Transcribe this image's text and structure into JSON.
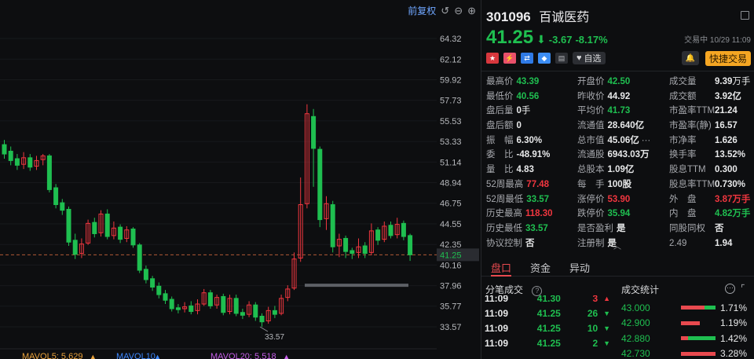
{
  "chart": {
    "toolbar": {
      "adjust_label": "前复权"
    },
    "price_ticks": [
      "64.32",
      "62.12",
      "59.92",
      "57.73",
      "55.53",
      "53.33",
      "51.14",
      "48.94",
      "46.75",
      "44.55",
      "42.35",
      "40.16",
      "37.96",
      "35.77",
      "33.57"
    ],
    "current_price_tag": "41.25",
    "low_label": "33.57",
    "mavol": [
      {
        "label": "MAVOL5: 5.629",
        "color": "#e9a23b"
      },
      {
        "label": "MAVOL10",
        "color": "#3d88ff"
      },
      {
        "label": "MAVOL20: 5.518",
        "color": "#c65ee8"
      }
    ],
    "colors": {
      "up": "#f0363f",
      "down": "#1fbf50",
      "dash": "#b05a36"
    }
  },
  "chart_data": {
    "type": "candlestick",
    "y_axis_ticks": [
      64.32,
      62.12,
      59.92,
      57.73,
      55.53,
      53.33,
      51.14,
      48.94,
      46.75,
      44.55,
      42.35,
      40.16,
      37.96,
      35.77,
      33.57
    ],
    "current_price": 41.25,
    "period_low": 33.57,
    "candles": [
      {
        "o": 53.0,
        "c": 52.0,
        "h": 53.5,
        "l": 51.5
      },
      {
        "o": 52.3,
        "c": 51.3,
        "h": 52.8,
        "l": 50.8
      },
      {
        "o": 51.5,
        "c": 50.8,
        "h": 52.0,
        "l": 50.3
      },
      {
        "o": 50.9,
        "c": 51.6,
        "h": 52.2,
        "l": 50.4
      },
      {
        "o": 51.6,
        "c": 50.6,
        "h": 52.0,
        "l": 50.2
      },
      {
        "o": 50.7,
        "c": 51.3,
        "h": 51.8,
        "l": 50.3
      },
      {
        "o": 51.4,
        "c": 51.8,
        "h": 52.0,
        "l": 50.8
      },
      {
        "o": 51.8,
        "c": 48.2,
        "h": 52.0,
        "l": 47.9
      },
      {
        "o": 48.4,
        "c": 46.6,
        "h": 48.8,
        "l": 46.2
      },
      {
        "o": 46.8,
        "c": 46.0,
        "h": 47.2,
        "l": 45.5
      },
      {
        "o": 46.1,
        "c": 42.6,
        "h": 46.4,
        "l": 42.2
      },
      {
        "o": 42.8,
        "c": 41.3,
        "h": 43.5,
        "l": 40.8
      },
      {
        "o": 41.4,
        "c": 42.4,
        "h": 43.0,
        "l": 40.9
      },
      {
        "o": 42.5,
        "c": 44.6,
        "h": 45.0,
        "l": 42.3
      },
      {
        "o": 44.7,
        "c": 43.5,
        "h": 45.2,
        "l": 43.1
      },
      {
        "o": 43.6,
        "c": 45.6,
        "h": 46.0,
        "l": 43.2
      },
      {
        "o": 45.6,
        "c": 43.2,
        "h": 46.1,
        "l": 42.9
      },
      {
        "o": 43.3,
        "c": 44.1,
        "h": 44.8,
        "l": 42.9
      },
      {
        "o": 44.2,
        "c": 42.9,
        "h": 44.5,
        "l": 42.5
      },
      {
        "o": 43.0,
        "c": 43.9,
        "h": 44.3,
        "l": 42.6
      },
      {
        "o": 44.0,
        "c": 42.3,
        "h": 44.2,
        "l": 42.0
      },
      {
        "o": 42.3,
        "c": 39.6,
        "h": 42.5,
        "l": 39.3
      },
      {
        "o": 39.7,
        "c": 38.6,
        "h": 40.1,
        "l": 38.2
      },
      {
        "o": 38.7,
        "c": 37.8,
        "h": 39.0,
        "l": 37.4
      },
      {
        "o": 37.9,
        "c": 37.0,
        "h": 38.3,
        "l": 36.6
      },
      {
        "o": 37.1,
        "c": 36.4,
        "h": 37.5,
        "l": 36.0
      },
      {
        "o": 36.5,
        "c": 35.5,
        "h": 36.8,
        "l": 35.2
      },
      {
        "o": 35.6,
        "c": 35.4,
        "h": 36.0,
        "l": 35.0
      },
      {
        "o": 35.5,
        "c": 35.7,
        "h": 36.2,
        "l": 35.1
      },
      {
        "o": 35.8,
        "c": 35.2,
        "h": 36.3,
        "l": 34.9
      },
      {
        "o": 35.3,
        "c": 36.0,
        "h": 36.5,
        "l": 34.9
      },
      {
        "o": 36.0,
        "c": 37.2,
        "h": 37.6,
        "l": 35.8
      },
      {
        "o": 37.2,
        "c": 35.8,
        "h": 37.5,
        "l": 35.5
      },
      {
        "o": 35.9,
        "c": 36.7,
        "h": 37.0,
        "l": 35.5
      },
      {
        "o": 36.8,
        "c": 35.1,
        "h": 37.1,
        "l": 34.8
      },
      {
        "o": 35.2,
        "c": 36.6,
        "h": 37.0,
        "l": 34.9
      },
      {
        "o": 36.6,
        "c": 35.0,
        "h": 37.0,
        "l": 34.7
      },
      {
        "o": 35.1,
        "c": 34.8,
        "h": 35.5,
        "l": 34.4
      },
      {
        "o": 34.9,
        "c": 35.9,
        "h": 36.3,
        "l": 34.6
      },
      {
        "o": 35.9,
        "c": 34.6,
        "h": 36.2,
        "l": 34.2
      },
      {
        "o": 34.7,
        "c": 34.1,
        "h": 35.0,
        "l": 33.57
      },
      {
        "o": 34.2,
        "c": 35.3,
        "h": 35.7,
        "l": 33.9
      },
      {
        "o": 35.3,
        "c": 34.9,
        "h": 35.8,
        "l": 34.5
      },
      {
        "o": 35.0,
        "c": 36.6,
        "h": 37.0,
        "l": 34.8
      },
      {
        "o": 36.7,
        "c": 37.6,
        "h": 38.0,
        "l": 36.3
      },
      {
        "o": 37.7,
        "c": 40.8,
        "h": 41.5,
        "l": 37.5
      },
      {
        "o": 40.9,
        "c": 46.6,
        "h": 49.5,
        "l": 40.5
      },
      {
        "o": 46.7,
        "c": 56.3,
        "h": 57.3,
        "l": 46.2
      },
      {
        "o": 56.0,
        "c": 52.6,
        "h": 56.8,
        "l": 48.5
      },
      {
        "o": 52.5,
        "c": 45.0,
        "h": 52.8,
        "l": 44.2
      },
      {
        "o": 45.1,
        "c": 46.7,
        "h": 47.5,
        "l": 43.9
      },
      {
        "o": 46.6,
        "c": 42.1,
        "h": 47.0,
        "l": 41.5
      },
      {
        "o": 42.2,
        "c": 42.9,
        "h": 43.5,
        "l": 41.0
      },
      {
        "o": 43.0,
        "c": 41.6,
        "h": 43.3,
        "l": 40.9
      },
      {
        "o": 41.7,
        "c": 41.4,
        "h": 42.0,
        "l": 40.8
      },
      {
        "o": 41.5,
        "c": 42.1,
        "h": 43.0,
        "l": 40.9
      },
      {
        "o": 42.2,
        "c": 41.4,
        "h": 42.6,
        "l": 40.9
      },
      {
        "o": 41.5,
        "c": 43.8,
        "h": 44.6,
        "l": 41.2
      },
      {
        "o": 43.9,
        "c": 42.8,
        "h": 44.2,
        "l": 42.3
      },
      {
        "o": 42.9,
        "c": 44.3,
        "h": 44.8,
        "l": 42.6
      },
      {
        "o": 44.4,
        "c": 43.3,
        "h": 44.8,
        "l": 43.0
      },
      {
        "o": 43.4,
        "c": 44.5,
        "h": 45.2,
        "l": 43.0
      },
      {
        "o": 44.6,
        "c": 43.2,
        "h": 44.9,
        "l": 42.8
      },
      {
        "o": 43.3,
        "c": 41.25,
        "h": 43.5,
        "l": 40.6
      }
    ]
  },
  "quote": {
    "code": "301096",
    "name": "百诚医药",
    "price": "41.25",
    "arrow": "⬇",
    "change": "-3.67",
    "change_pct": "-8.17%",
    "status": "交易中 10/29 11:09",
    "tags": [
      {
        "text": "★",
        "cls": "red",
        "name": "cn-flag-icon"
      },
      {
        "text": "⚡",
        "cls": "pink",
        "name": "margin-icon"
      },
      {
        "text": "⇄",
        "cls": "blue",
        "name": "connect-icon"
      },
      {
        "text": "◆",
        "cls": "blue2",
        "name": "tag-icon"
      },
      {
        "text": "▤",
        "cls": "gray",
        "name": "doc-icon"
      }
    ],
    "watch_label": "自选",
    "bell_icon": "bell-icon",
    "fast_trade_label": "快捷交易"
  },
  "stats": [
    [
      {
        "label": "最高价",
        "value": "43.39",
        "cls": "green"
      },
      {
        "label": "开盘价",
        "value": "42.50",
        "cls": "green"
      },
      {
        "label": "成交量",
        "value": "9.39",
        "unit": "万手",
        "cls": ""
      }
    ],
    [
      {
        "label": "最低价",
        "value": "40.56",
        "cls": "green"
      },
      {
        "label": "昨收价",
        "value": "44.92",
        "cls": ""
      },
      {
        "label": "成交额",
        "value": "3.92亿",
        "cls": ""
      }
    ],
    [
      {
        "label": "盘后量",
        "value": "0",
        "unit": "手",
        "cls": ""
      },
      {
        "label": "平均价",
        "value": "41.73",
        "cls": "green"
      },
      {
        "label": "市盈率TTM",
        "value": "21.24",
        "cls": ""
      }
    ],
    [
      {
        "label": "盘后额",
        "value": "0",
        "cls": ""
      },
      {
        "label": "流通值",
        "value": "28.640亿",
        "cls": ""
      },
      {
        "label": "市盈率(静)",
        "value": "16.57",
        "cls": ""
      }
    ],
    [
      {
        "label": "振　幅",
        "value": "6.30%",
        "cls": ""
      },
      {
        "label": "总市值",
        "value": "45.06亿",
        "extra": "⋯",
        "cls": ""
      },
      {
        "label": "市净率",
        "value": "1.626",
        "cls": ""
      }
    ],
    [
      {
        "label": "委　比",
        "value": "-48.91%",
        "cls": ""
      },
      {
        "label": "流通股",
        "value": "6943.03万",
        "cls": ""
      },
      {
        "label": "换手率",
        "value": "13.52%",
        "cls": ""
      }
    ],
    [
      {
        "label": "量　比",
        "value": "4.83",
        "cls": ""
      },
      {
        "label": "总股本",
        "value": "1.09亿",
        "cls": ""
      },
      {
        "label": "股息TTM",
        "value": "0.300",
        "cls": ""
      }
    ],
    [
      {
        "label": "52周最高",
        "value": "77.48",
        "cls": "red"
      },
      {
        "label": "每　手",
        "value": "100股",
        "cls": ""
      },
      {
        "label": "股息率TTM",
        "value": "0.730%",
        "cls": ""
      }
    ],
    [
      {
        "label": "52周最低",
        "value": "33.57",
        "cls": "green"
      },
      {
        "label": "涨停价",
        "value": "53.90",
        "cls": "red"
      },
      {
        "label": "外　盘",
        "value": "3.87",
        "unit": "万手",
        "cls": "red"
      }
    ],
    [
      {
        "label": "历史最高",
        "value": "118.30",
        "cls": "red"
      },
      {
        "label": "跌停价",
        "value": "35.94",
        "cls": "green"
      },
      {
        "label": "内　盘",
        "value": "4.82",
        "unit": "万手",
        "cls": "green"
      }
    ],
    [
      {
        "label": "历史最低",
        "value": "33.57",
        "cls": "green"
      },
      {
        "label": "是否盈利",
        "value": "是",
        "cls": ""
      },
      {
        "label": "同股同权",
        "value": "否",
        "cls": ""
      }
    ],
    [
      {
        "label": "协议控制",
        "value": "否",
        "cls": ""
      },
      {
        "label": "注册制",
        "value": "是",
        "cls": ""
      },
      {
        "label": "2.49",
        "value": "1.94",
        "cls": ""
      }
    ]
  ],
  "tabs": [
    "盘口",
    "资金",
    "异动"
  ],
  "tape": {
    "title": "分笔成交",
    "rows": [
      {
        "time": "11:09",
        "price": "41.30",
        "vol": "3",
        "dir": "▲",
        "dir_color": "#f0363f"
      },
      {
        "time": "11:09",
        "price": "41.25",
        "vol": "26",
        "dir": "▼",
        "dir_color": "#1fbf50"
      },
      {
        "time": "11:09",
        "price": "41.25",
        "vol": "10",
        "dir": "▼",
        "dir_color": "#1fbf50"
      },
      {
        "time": "11:09",
        "price": "41.25",
        "vol": "2",
        "dir": "▼",
        "dir_color": "#1fbf50"
      }
    ]
  },
  "volume_stats": {
    "title": "成交统计",
    "rows": [
      {
        "price": "43.000",
        "red": 0.68,
        "green": 0.32,
        "pct": "1.71%"
      },
      {
        "price": "42.900",
        "red": 0.55,
        "green": 0.0,
        "pct": "1.19%"
      },
      {
        "price": "42.880",
        "red": 0.2,
        "green": 0.8,
        "pct": "1.42%"
      },
      {
        "price": "42.730",
        "red": 1.0,
        "green": 0.0,
        "pct": "3.28%"
      }
    ]
  }
}
